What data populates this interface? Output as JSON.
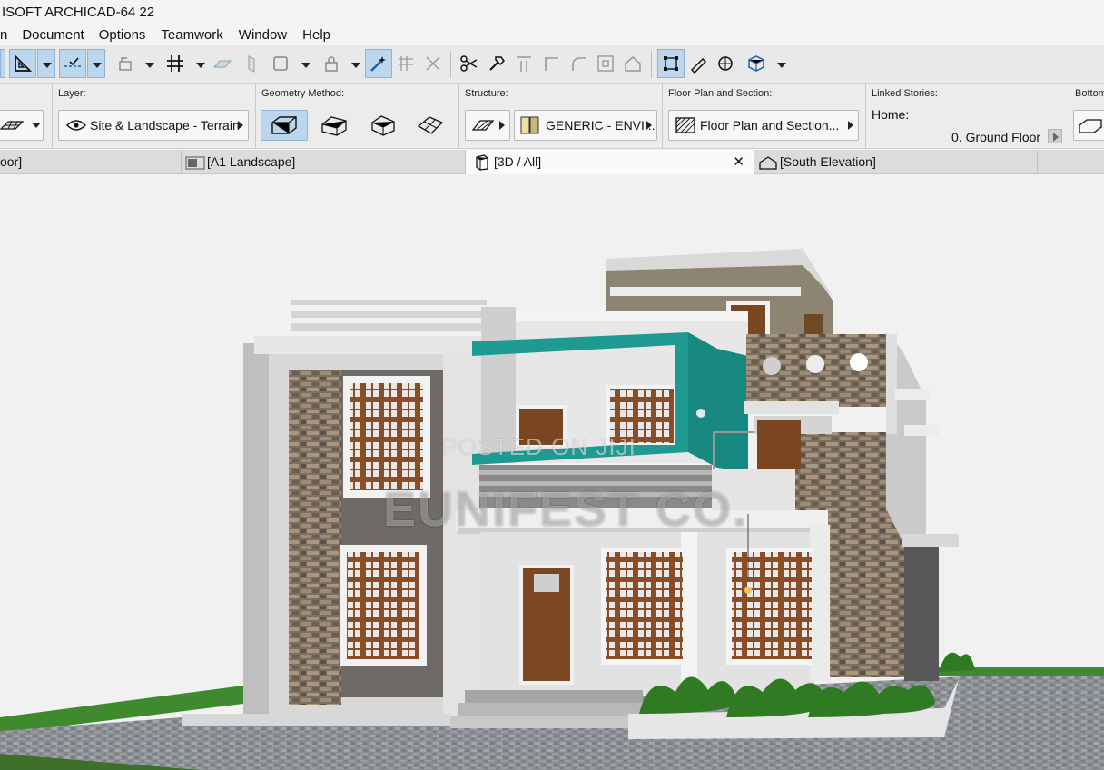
{
  "app": {
    "title": "ISOFT ARCHICAD-64 22"
  },
  "menu": [
    "n",
    "Document",
    "Options",
    "Teamwork",
    "Window",
    "Help"
  ],
  "info": {
    "layer_label": "Layer:",
    "layer_value": "Site & Landscape - Terrain",
    "geometry_label": "Geometry Method:",
    "structure_label": "Structure:",
    "structure_value": "GENERIC - ENVI...",
    "floorplan_label": "Floor Plan and Section:",
    "floorplan_value": "Floor Plan and Section...",
    "linked_label": "Linked Stories:",
    "home_label": "Home:",
    "home_value": "0. Ground Floor",
    "bottom_label": "Bottom"
  },
  "tabs": [
    {
      "label": "oor]"
    },
    {
      "label": "[A1 Landscape]"
    },
    {
      "label": "[3D / All]"
    },
    {
      "label": "[South Elevation]"
    }
  ],
  "watermark": {
    "line1": "POSTED ON JIJI",
    "line2": "EUNIFEST CO."
  },
  "colors": {
    "accent_teal": "#1f9a92",
    "toolbar_active": "#bcd6ee"
  }
}
